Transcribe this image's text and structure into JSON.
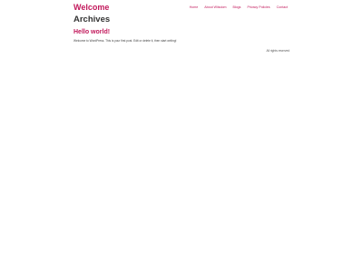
{
  "site": {
    "title": "Welcome"
  },
  "nav": {
    "items": [
      {
        "label": "Home"
      },
      {
        "label": "About Wiisdom"
      },
      {
        "label": "Blogs"
      },
      {
        "label": "Privacy Policies"
      },
      {
        "label": "Contact"
      }
    ]
  },
  "main": {
    "page_title": "Archives",
    "posts": [
      {
        "title": "Hello world!",
        "excerpt": "Welcome to WordPress. This is your first post. Edit or delete it, then start writing!"
      }
    ]
  },
  "footer": {
    "copyright": "All rights reserved"
  },
  "colors": {
    "accent": "#c2185b",
    "heading": "#333333",
    "background": "#ffffff"
  }
}
